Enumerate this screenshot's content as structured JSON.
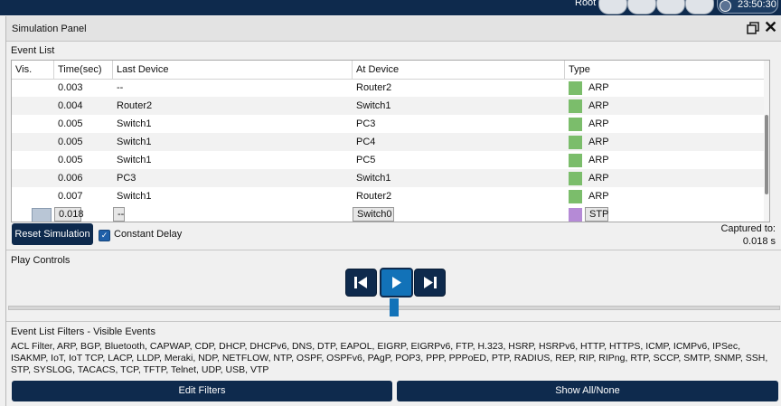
{
  "topbar": {
    "user": "Root",
    "clock": "23:50:30"
  },
  "panel": {
    "title": "Simulation Panel"
  },
  "event_list": {
    "label": "Event List",
    "columns": [
      "Vis.",
      "Time(sec)",
      "Last Device",
      "At Device",
      "Type"
    ],
    "rows": [
      {
        "time": "0.003",
        "last": "--",
        "at": "Router2",
        "type": "ARP",
        "color": "#7bbd6b"
      },
      {
        "time": "0.004",
        "last": "Router2",
        "at": "Switch1",
        "type": "ARP",
        "color": "#7bbd6b"
      },
      {
        "time": "0.005",
        "last": "Switch1",
        "at": "PC3",
        "type": "ARP",
        "color": "#7bbd6b"
      },
      {
        "time": "0.005",
        "last": "Switch1",
        "at": "PC4",
        "type": "ARP",
        "color": "#7bbd6b"
      },
      {
        "time": "0.005",
        "last": "Switch1",
        "at": "PC5",
        "type": "ARP",
        "color": "#7bbd6b"
      },
      {
        "time": "0.006",
        "last": "PC3",
        "at": "Switch1",
        "type": "ARP",
        "color": "#7bbd6b"
      },
      {
        "time": "0.007",
        "last": "Switch1",
        "at": "Router2",
        "type": "ARP",
        "color": "#7bbd6b"
      },
      {
        "time": "0.018",
        "last": "--",
        "at": "Switch0",
        "type": "STP",
        "color": "#b58ad6"
      }
    ]
  },
  "controls": {
    "reset_label": "Reset Simulation",
    "constant_delay_label": "Constant Delay",
    "captured_label": "Captured to:",
    "captured_value": "0.018 s"
  },
  "play_controls": {
    "label": "Play Controls"
  },
  "filters": {
    "label": "Event List Filters - Visible Events",
    "text": "ACL Filter, ARP, BGP, Bluetooth, CAPWAP, CDP, DHCP, DHCPv6, DNS, DTP, EAPOL, EIGRP, EIGRPv6, FTP, H.323, HSRP, HSRPv6, HTTP, HTTPS, ICMP, ICMPv6, IPSec, ISAKMP, IoT, IoT TCP, LACP, LLDP, Meraki, NDP, NETFLOW, NTP, OSPF, OSPFv6, PAgP, POP3, PPP, PPPoED, PTP, RADIUS, REP, RIP, RIPng, RTP, SCCP, SMTP, SNMP, SSH, STP, SYSLOG, TACACS, TCP, TFTP, Telnet, UDP, USB, VTP",
    "edit_label": "Edit Filters",
    "show_label": "Show All/None"
  }
}
